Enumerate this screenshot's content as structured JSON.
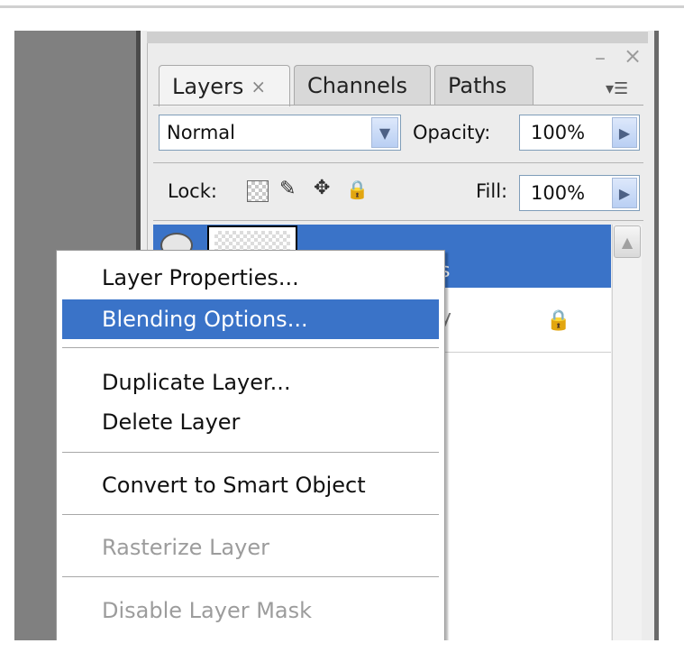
{
  "panel": {
    "minimize_glyph": "–",
    "close_glyph": "×",
    "menu_glyph": "▾☰",
    "tabs": [
      {
        "label": "Layers",
        "close": "×"
      },
      {
        "label": "Channels"
      },
      {
        "label": "Paths"
      }
    ]
  },
  "controls": {
    "blend_mode": "Normal",
    "opacity_label": "Opacity:",
    "opacity_value": "100%",
    "lock_label": "Lock:",
    "fill_label": "Fill:",
    "fill_value": "100%",
    "arrow_down": "▼",
    "arrow_right": "▶"
  },
  "layers": {
    "row1_partial_text": "s",
    "row2_partial_text": "y",
    "lock_glyph": "🔒"
  },
  "scrollbar": {
    "up_glyph": "▲"
  },
  "context_menu": {
    "items": [
      {
        "label": "Layer Properties..."
      },
      {
        "label": "Blending Options..."
      },
      {
        "label": "Duplicate Layer..."
      },
      {
        "label": "Delete Layer"
      },
      {
        "label": "Convert to Smart Object"
      },
      {
        "label": "Rasterize Layer"
      },
      {
        "label": "Disable Layer Mask"
      }
    ]
  },
  "colors": {
    "selection_blue": "#3a73c8",
    "canvas_gray": "#808080",
    "panel_bg": "#ececec",
    "disabled_text": "#9c9c9c"
  }
}
